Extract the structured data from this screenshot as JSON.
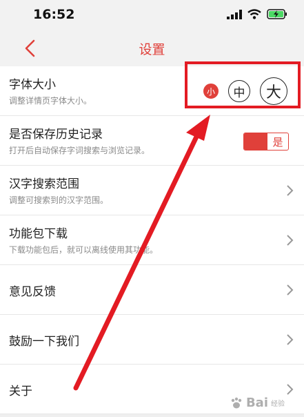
{
  "status": {
    "time": "16:52"
  },
  "nav": {
    "title": "设置"
  },
  "rows": [
    {
      "title": "字体大小",
      "subtitle": "调整详情页字体大小。"
    },
    {
      "title": "是否保存历史记录",
      "subtitle": "打开后自动保存字词搜索与浏览记录。"
    },
    {
      "title": "汉字搜索范围",
      "subtitle": "调整可搜索到的汉字范围。"
    },
    {
      "title": "功能包下载",
      "subtitle": "下载功能包后，就可以离线使用其功能。"
    },
    {
      "title": "意见反馈"
    },
    {
      "title": "鼓励一下我们"
    },
    {
      "title": "关于"
    }
  ],
  "font_size": {
    "small": "小",
    "medium": "中",
    "large": "大",
    "selected": "small"
  },
  "history_toggle": {
    "label": "是",
    "on": true
  },
  "watermark": {
    "text": "Bai",
    "suffix": "经验"
  },
  "colors": {
    "accent": "#e0403a",
    "annotation": "#e31b23"
  }
}
